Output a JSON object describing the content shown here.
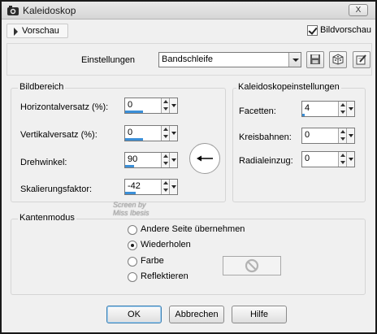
{
  "window": {
    "title": "Kaleidoskop",
    "close_label": "X"
  },
  "preview": {
    "toggle_label": "Vorschau",
    "live_preview_label": "Bildvorschau",
    "live_preview_checked": true
  },
  "settings": {
    "label": "Einstellungen",
    "preset_value": "Bandschleife"
  },
  "bildbereich": {
    "title": "Bildbereich",
    "fields": [
      {
        "label": "Horizontalversatz (%):",
        "value": "0",
        "level": 0.5
      },
      {
        "label": "Vertikalversatz (%):",
        "value": "0",
        "level": 0.5
      },
      {
        "label": "Drehwinkel:",
        "value": "90",
        "level": 0.25
      },
      {
        "label": "Skalierungsfaktor:",
        "value": "-42",
        "level": 0.29
      }
    ]
  },
  "kaleido": {
    "title": "Kaleidoskopeinstellungen",
    "fields": [
      {
        "label": "Facetten:",
        "value": "4",
        "level": 0.06
      },
      {
        "label": "Kreisbahnen:",
        "value": "0",
        "level": 0
      },
      {
        "label": "Radialeinzug:",
        "value": "0",
        "level": 0
      }
    ]
  },
  "kantenmodus": {
    "title": "Kantenmodus",
    "options": [
      {
        "label": "Andere Seite übernehmen",
        "selected": false
      },
      {
        "label": "Wiederholen",
        "selected": true
      },
      {
        "label": "Farbe",
        "selected": false
      },
      {
        "label": "Reflektieren",
        "selected": false
      }
    ]
  },
  "watermark": {
    "line1": "Screen by",
    "line2": "Miss Ibesis"
  },
  "buttons": {
    "ok": "OK",
    "cancel": "Abbrechen",
    "help": "Hilfe"
  },
  "colors": {
    "accent": "#3b8fd8",
    "window_bg": "#f0f0f0"
  }
}
